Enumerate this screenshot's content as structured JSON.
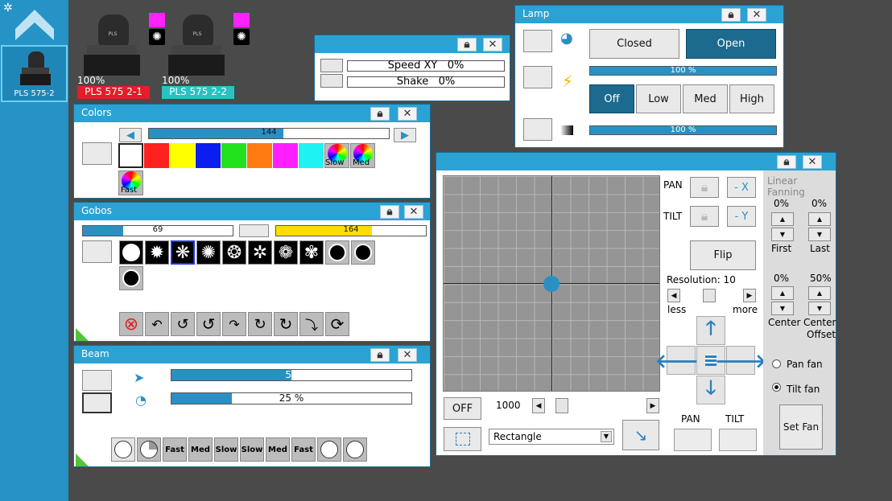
{
  "sidebar": {
    "device_label": "PLS 575-2"
  },
  "fixtures": [
    {
      "percent": "100%",
      "name": "PLS 575 2-1",
      "name_color": "#e51d2a"
    },
    {
      "percent": "100%",
      "name": "PLS 575 2-2",
      "name_color": "#27c3c3"
    }
  ],
  "speed_window": {
    "speed_xy": "Speed XY",
    "speed_val": "0%",
    "shake": "Shake",
    "shake_val": "0%"
  },
  "lamp": {
    "title": "Lamp",
    "closed": "Closed",
    "open": "Open",
    "bar1": "100 %",
    "off": "Off",
    "low": "Low",
    "med": "Med",
    "high": "High",
    "bar2": "100 %",
    "bar1_fill": 1.0,
    "bar2_fill": 1.0
  },
  "colors": {
    "title": "Colors",
    "slider_value": "144",
    "slider_fill": 0.56,
    "slow": "Slow",
    "med": "Med",
    "fast": "Fast",
    "swatches": [
      "#ffffff",
      "#ff2020",
      "#ffff00",
      "#0a1ef0",
      "#22e21e",
      "#ff7a10",
      "#ff1eff",
      "#1ef2f2"
    ]
  },
  "gobos": {
    "title": "Gobos",
    "bar1_value": "69",
    "bar1_fill": 0.27,
    "bar2_value": "164",
    "bar2_fill": 0.64
  },
  "beam": {
    "title": "Beam",
    "bar1": "50",
    "bar1_fill": 0.5,
    "bar2": "25 %",
    "bar2_fill": 0.25,
    "effects": [
      "Fast",
      "Med",
      "Slow",
      "Slow",
      "Med",
      "Fast"
    ]
  },
  "position": {
    "pan": "PAN",
    "tilt": "TILT",
    "minus_x": "- X",
    "minus_y": "- Y",
    "flip": "Flip",
    "resolution": "Resolution: 10",
    "less": "less",
    "more": "more",
    "off": "OFF",
    "speed_value": "1000",
    "shape_select": "Rectangle",
    "pan_bottom": "PAN",
    "tilt_bottom": "TILT"
  },
  "fanning": {
    "title": "Linear Fanning",
    "p1": "0%",
    "p2": "0%",
    "first": "First",
    "last": "Last",
    "p3": "0%",
    "p4": "50%",
    "center": "Center",
    "center_offset_1": "Center",
    "center_offset_2": "Offset",
    "pan_fan": "Pan fan",
    "tilt_fan": "Tilt fan",
    "set_fan": "Set Fan"
  }
}
